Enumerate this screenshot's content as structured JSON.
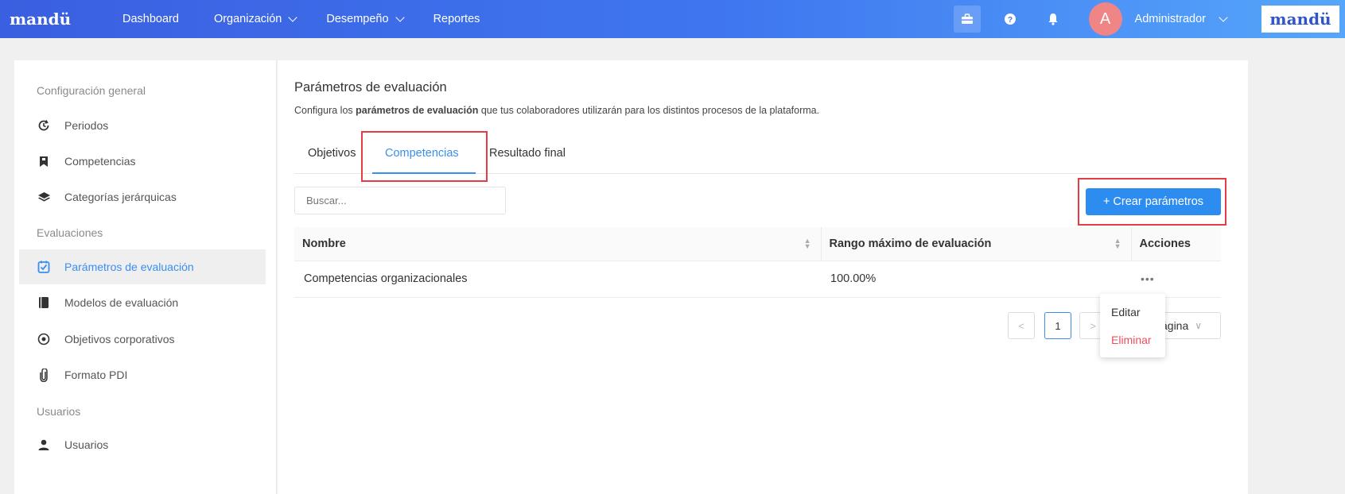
{
  "nav": {
    "logo": "mandü",
    "items": [
      {
        "label": "Dashboard",
        "dropdown": false
      },
      {
        "label": "Organización",
        "dropdown": true
      },
      {
        "label": "Desempeño",
        "dropdown": true
      },
      {
        "label": "Reportes",
        "dropdown": false
      }
    ],
    "avatar_letter": "A",
    "user": "Administrador",
    "brand": "mandü"
  },
  "sidebar": {
    "section_general": "Configuración general",
    "section_evaluaciones": "Evaluaciones",
    "section_usuarios": "Usuarios",
    "items": [
      {
        "label": "Periodos",
        "icon": "clock-icon"
      },
      {
        "label": "Competencias",
        "icon": "bookmark-icon"
      },
      {
        "label": "Categorías jerárquicas",
        "icon": "layers-icon"
      },
      {
        "label": "Parámetros de evaluación",
        "icon": "checkbox-icon",
        "active": true
      },
      {
        "label": "Modelos de evaluación",
        "icon": "book-icon"
      },
      {
        "label": "Objetivos corporativos",
        "icon": "target-icon"
      },
      {
        "label": "Formato PDI",
        "icon": "paperclip-icon"
      },
      {
        "label": "Usuarios",
        "icon": "user-icon"
      }
    ]
  },
  "main": {
    "title": "Parámetros de evaluación",
    "description_pre": "Configura los ",
    "description_bold": "parámetros de evaluación",
    "description_post": " que tus colaboradores utilizarán para los distintos procesos de la plataforma.",
    "tabs": [
      "Objetivos",
      "Competencias",
      "Resultado final"
    ],
    "active_tab": "Competencias",
    "search_placeholder": "Buscar...",
    "create_button": "+ Crear parámetros",
    "table": {
      "columns": [
        "Nombre",
        "Rango máximo de evaluación",
        "Acciones"
      ],
      "rows": [
        {
          "name": "Competencias organizacionales",
          "range": "100.00%",
          "actions": "•••"
        }
      ]
    },
    "pagination": {
      "prev": "<",
      "page": "1",
      "next": ">",
      "per_page": "ágina"
    },
    "dropdown": {
      "edit": "Editar",
      "delete": "Eliminar"
    }
  },
  "colors": {
    "accent": "#2d8cf0",
    "highlight": "#e53c46",
    "danger": "#ed4f5b"
  }
}
